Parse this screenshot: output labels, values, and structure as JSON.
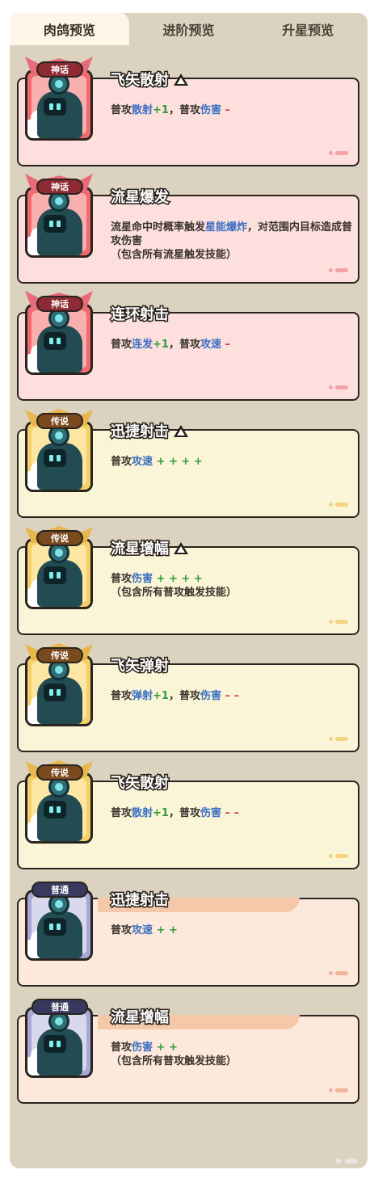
{
  "tabs": [
    {
      "label": "肉鸽预览",
      "active": true
    },
    {
      "label": "进阶预览",
      "active": false
    },
    {
      "label": "升星预览",
      "active": false
    }
  ],
  "colors": {
    "myth_badge": "#8e2a33",
    "legend_badge": "#7a4a1e",
    "common_badge": "#39395e",
    "keyword_blue": "#3b6fc2",
    "plus_green": "#2e9a38",
    "minus_red": "#d53a3a"
  },
  "cards": [
    {
      "rarity": "神话",
      "title": "飞矢散射",
      "upgrade_icon": "triangle-icon",
      "desc": [
        {
          "t": "普攻"
        },
        {
          "t": "散射",
          "c": "kw"
        },
        {
          "t": "+1",
          "c": "up"
        },
        {
          "t": "，普攻"
        },
        {
          "t": "伤害",
          "c": "kw"
        },
        {
          "t": " –",
          "c": "down"
        }
      ]
    },
    {
      "rarity": "神话",
      "title": "流星爆发",
      "desc": [
        {
          "t": "流星命中时概率触发"
        },
        {
          "t": "星能爆炸",
          "c": "kw"
        },
        {
          "t": "，对范围内目标造成普攻伤害"
        },
        {
          "t": "（包含所有流星触发技能）",
          "br": true
        }
      ]
    },
    {
      "rarity": "神话",
      "title": "连环射击",
      "desc": [
        {
          "t": "普攻"
        },
        {
          "t": "连发",
          "c": "kw"
        },
        {
          "t": "+1",
          "c": "up"
        },
        {
          "t": "，普攻"
        },
        {
          "t": "攻速",
          "c": "kw"
        },
        {
          "t": " –",
          "c": "down"
        }
      ]
    },
    {
      "rarity": "传说",
      "title": "迅捷射击",
      "upgrade_icon": "triangle-icon",
      "desc": [
        {
          "t": "普攻"
        },
        {
          "t": "攻速",
          "c": "kw"
        },
        {
          "t": " + + + +",
          "c": "up"
        }
      ]
    },
    {
      "rarity": "传说",
      "title": "流星增幅",
      "upgrade_icon": "triangle-icon",
      "desc": [
        {
          "t": "普攻"
        },
        {
          "t": "伤害",
          "c": "kw"
        },
        {
          "t": " + + + +",
          "c": "up"
        },
        {
          "t": "（包含所有普攻触发技能）",
          "br": true
        }
      ]
    },
    {
      "rarity": "传说",
      "title": "飞矢弹射",
      "desc": [
        {
          "t": "普攻"
        },
        {
          "t": "弹射",
          "c": "kw"
        },
        {
          "t": "+1",
          "c": "up"
        },
        {
          "t": "，普攻"
        },
        {
          "t": "伤害",
          "c": "kw"
        },
        {
          "t": " – –",
          "c": "down"
        }
      ]
    },
    {
      "rarity": "传说",
      "title": "飞矢散射",
      "desc": [
        {
          "t": "普攻"
        },
        {
          "t": "散射",
          "c": "kw"
        },
        {
          "t": "+1",
          "c": "up"
        },
        {
          "t": "，普攻"
        },
        {
          "t": "伤害",
          "c": "kw"
        },
        {
          "t": " – –",
          "c": "down"
        }
      ]
    },
    {
      "rarity": "普通",
      "title": "迅捷射击",
      "desc": [
        {
          "t": "普攻"
        },
        {
          "t": "攻速",
          "c": "kw"
        },
        {
          "t": " + +",
          "c": "up"
        }
      ]
    },
    {
      "rarity": "普通",
      "title": "流星增幅",
      "desc": [
        {
          "t": "普攻"
        },
        {
          "t": "伤害",
          "c": "kw"
        },
        {
          "t": " + +",
          "c": "up"
        },
        {
          "t": "（包含所有普攻触发技能）",
          "br": true
        }
      ]
    }
  ]
}
